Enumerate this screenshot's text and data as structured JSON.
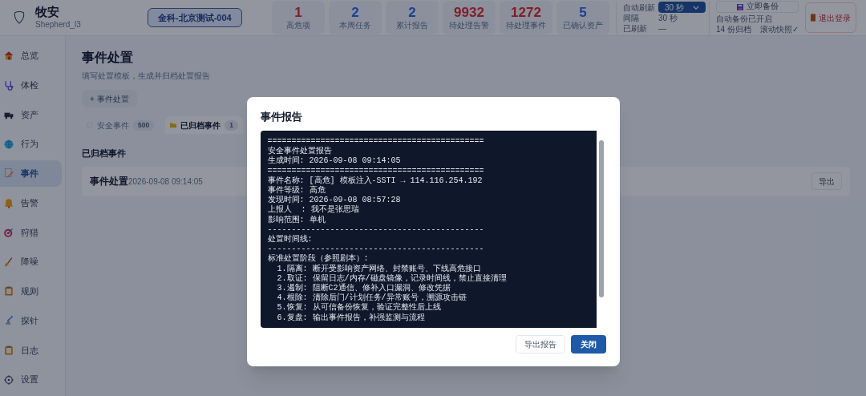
{
  "header": {
    "app_name": "牧安",
    "app_subtitle": "Shepherd_l3",
    "tenant": "金科-北京测试-004",
    "stats": [
      {
        "value": "1",
        "label": "高危项",
        "kind": "alert"
      },
      {
        "value": "2",
        "label": "本周任务",
        "kind": "normal"
      },
      {
        "value": "2",
        "label": "累计报告",
        "kind": "normal"
      },
      {
        "value": "9932",
        "label": "待处理告警",
        "kind": "alert"
      },
      {
        "value": "1272",
        "label": "待处理事件",
        "kind": "alert"
      },
      {
        "value": "5",
        "label": "已确认资产",
        "kind": "normal"
      }
    ],
    "refresh": {
      "label": "自动刷新",
      "select_value": "30 秒",
      "interval_label": "间隔",
      "interval_value": "30 秒",
      "refreshed_label": "已刷新",
      "refreshed_value": "—"
    },
    "backup": {
      "button": "立即备份",
      "status": "自动备份已开启",
      "archives": "14 份归档",
      "snapshot": "滚动快照✓"
    },
    "logout": "退出登录"
  },
  "sidebar": {
    "items": [
      {
        "label": "总览",
        "selected": false
      },
      {
        "label": "体检",
        "selected": false
      },
      {
        "label": "资产",
        "selected": false
      },
      {
        "label": "行为",
        "selected": false
      },
      {
        "label": "事件",
        "selected": true
      },
      {
        "label": "告警",
        "selected": false
      },
      {
        "label": "狩猎",
        "selected": false
      },
      {
        "label": "降噪",
        "selected": false
      },
      {
        "label": "规则",
        "selected": false
      },
      {
        "label": "探针",
        "selected": false
      },
      {
        "label": "日志",
        "selected": false
      },
      {
        "label": "设置",
        "selected": false
      }
    ]
  },
  "page": {
    "title": "事件处置",
    "subtitle": "填写处置模板，生成并归档处置报告",
    "new_button": "+ 事件处置",
    "tabs": [
      {
        "label": "安全事件",
        "count": "500",
        "selected": false
      },
      {
        "label": "已归档事件",
        "count": "1",
        "selected": true
      }
    ],
    "section_title": "已归档事件",
    "archived": [
      {
        "title": "事件处置",
        "time": "2026-09-08 09:14:05",
        "action": "导出"
      }
    ]
  },
  "dialog": {
    "title": "事件报告",
    "report_lines": [
      "=============================================",
      "安全事件处置报告",
      "生成时间: 2026-09-08 09:14:05",
      "=============================================",
      "事件名称: [高危] 模板注入-SSTI → 114.116.254.192",
      "事件等级: 高危",
      "发现时间: 2026-09-08 08:57:28",
      "上报人  : 我不是张思瑞",
      "影响范围: 单机",
      "---------------------------------------------",
      "处置时间线:",
      "---------------------------------------------",
      "标准处置阶段（参照剧本）:",
      "  1.隔离: 断开受影响资产网络、封禁账号、下线高危接口",
      "  2.取证: 保留日志/内存/磁盘镜像，记录时间线，禁止直接清理",
      "  3.遏制: 阻断C2通信、修补入口漏洞、修改凭据",
      "  4.根除: 清除后门/计划任务/异常账号，溯源攻击链",
      "  5.恢复: 从可信备份恢复，验证完整性后上线",
      "  6.复盘: 输出事件报告，补强监测与流程"
    ],
    "buttons": [
      {
        "label": "导出报告",
        "kind": "secondary"
      },
      {
        "label": "关闭",
        "kind": "primary"
      }
    ]
  }
}
